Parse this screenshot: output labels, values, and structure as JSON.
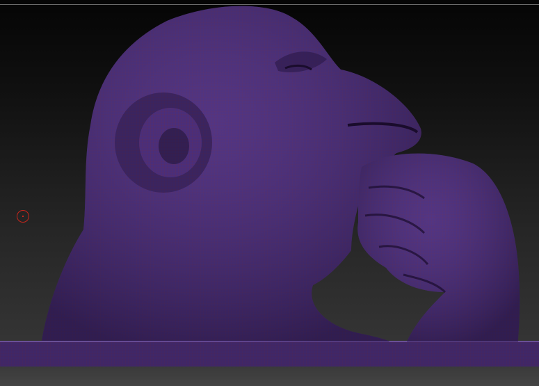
{
  "viewport": {
    "subject_icon": "chimpanzee-thinker-sculpt",
    "mesh_color": "#4a2e7a",
    "wire_color": "#8a2f2f",
    "background_top": "#050505",
    "background_bottom": "#3a3a3a"
  },
  "brush_cursor": {
    "icon": "brush-cursor-ring",
    "color": "#c8261c"
  }
}
